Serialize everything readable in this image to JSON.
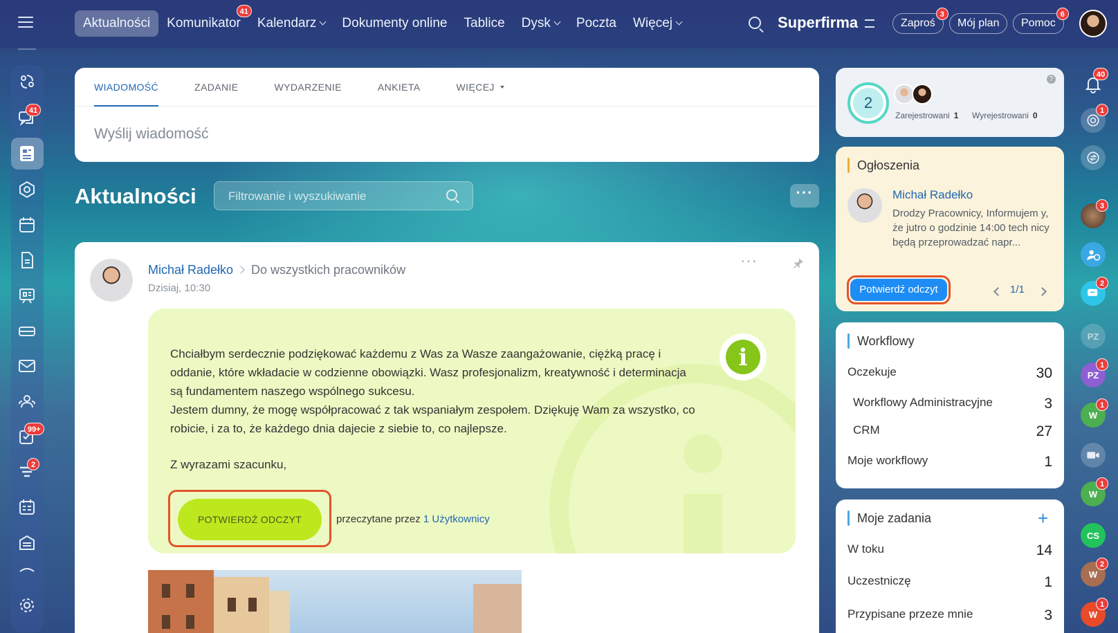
{
  "topnav": {
    "items": [
      {
        "label": "Aktualności",
        "active": true
      },
      {
        "label": "Komunikator",
        "badge": "41"
      },
      {
        "label": "Kalendarz",
        "dropdown": true
      },
      {
        "label": "Dokumenty online"
      },
      {
        "label": "Tablice"
      },
      {
        "label": "Dysk",
        "dropdown": true
      },
      {
        "label": "Poczta"
      },
      {
        "label": "Więcej",
        "dropdown": true
      }
    ],
    "brand": "Superfirma",
    "invite": {
      "label": "Zaproś",
      "badge": "3"
    },
    "plan": {
      "label": "Mój plan"
    },
    "help": {
      "label": "Pomoc",
      "badge": "6"
    }
  },
  "left_sidebar": {
    "badges": {
      "chat": "41",
      "tasks": "99+",
      "filter": "2"
    }
  },
  "compose": {
    "tabs": [
      "WIADOMOŚĆ",
      "ZADANIE",
      "WYDARZENIE",
      "ANKIETA",
      "WIĘCEJ"
    ],
    "placeholder": "Wyślij wiadomość"
  },
  "feed": {
    "title": "Aktualności",
    "filter_placeholder": "Filtrowanie i wyszukiwanie"
  },
  "post": {
    "author": "Michał Radełko",
    "destination": "Do wszystkich pracowników",
    "date": "Dzisiaj, 10:30",
    "paragraphs": [
      "Chciałbym serdecznie podziękować każdemu z Was za Wasze zaangażowanie, ciężką pracę i oddanie, które wkładacie w codzienne obowiązki. Wasz profesjonalizm, kreatywność i determinacja są fundamentem naszego wspólnego sukcesu.",
      "Jestem dumny, że mogę współpracować z tak wspaniałym zespołem. Dziękuję Wam za wszystko, co robicie, i za to, że każdego dnia dajecie z siebie to, co najlepsze."
    ],
    "regards": "Z wyrazami szacunku,",
    "confirm_label": "POTWIERDŹ ODCZYT",
    "read_by_prefix": "przeczytane przez",
    "read_by_link": "1 Użytkownicy"
  },
  "registration": {
    "count": "2",
    "registered_label": "Zarejestrowani",
    "registered_value": "1",
    "unregistered_label": "Wyrejestrowani",
    "unregistered_value": "0",
    "help": "?"
  },
  "announcements": {
    "title": "Ogłoszenia",
    "author": "Michał Radełko",
    "text": "Drodzy Pracownicy, Informujem y, że jutro o godzinie 14:00 tech nicy będą przeprowadzać napr...",
    "button": "Potwierdź odczyt",
    "pager": "1/1"
  },
  "workflows": {
    "title": "Workflowy",
    "rows": [
      {
        "label": "Oczekuje",
        "value": "30"
      },
      {
        "label": "Workflowy Administracyjne",
        "value": "3"
      },
      {
        "label": "CRM",
        "value": "27"
      },
      {
        "label": "Moje workflowy",
        "value": "1"
      }
    ]
  },
  "tasks": {
    "title": "Moje zadania",
    "rows": [
      {
        "label": "W toku",
        "value": "14"
      },
      {
        "label": "Uczestniczę",
        "value": "1"
      },
      {
        "label": "Przypisane przeze mnie",
        "value": "3"
      }
    ]
  },
  "right_sidebar": {
    "badges": {
      "notifications": "40",
      "goals": "1",
      "team": "3",
      "chat": "2",
      "pz2": "1",
      "w1": "1",
      "w2": "1",
      "w3": "2",
      "w4": "1"
    },
    "initials": {
      "pz1": "PZ",
      "pz2": "PZ",
      "w1": "W",
      "w2": "W",
      "cs": "CS",
      "w3": "W",
      "w4": "W"
    }
  },
  "colors": {
    "accent": "#2067b0",
    "confirm_green": "#bde81d",
    "announce_button": "#1e8cf5",
    "highlight": "#e2542a",
    "badge": "#ec3c3c"
  }
}
